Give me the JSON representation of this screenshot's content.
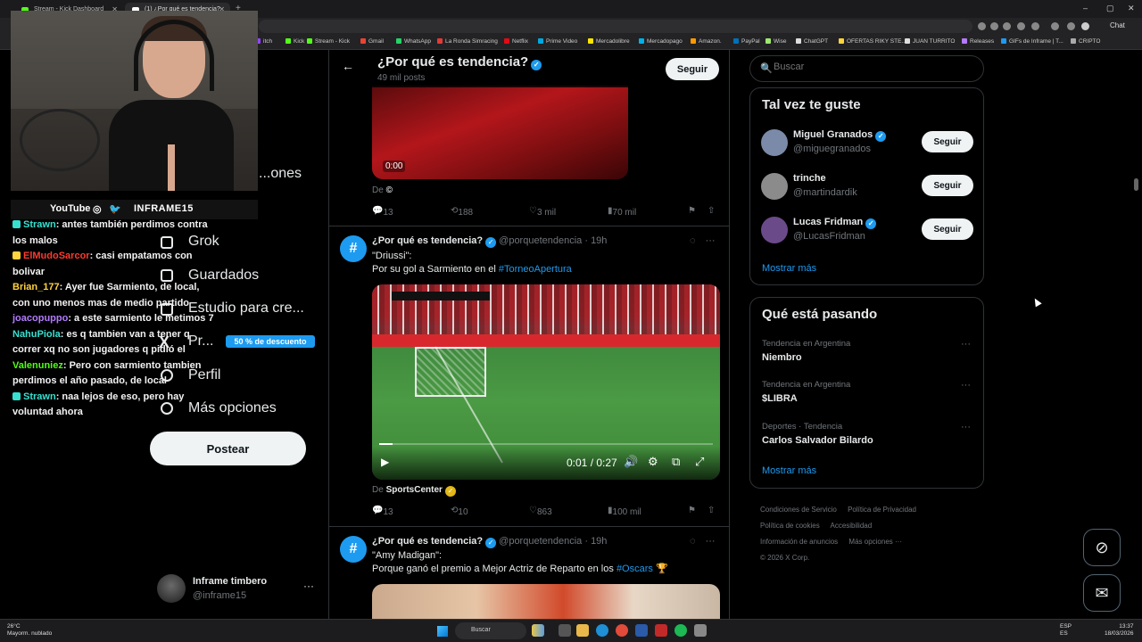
{
  "browser": {
    "tabs": [
      {
        "title": "Stream - Kick Dashboard"
      },
      {
        "title": "(1) ¿Por qué es tendencia? (@porq"
      }
    ],
    "new_tab": "+",
    "window_controls": {
      "minimize": "–",
      "maximize": "▢",
      "close": "✕"
    },
    "chat_extension": "Chat",
    "bookmarks": [
      {
        "label": "itch",
        "color": "#9146ff"
      },
      {
        "label": "Kick",
        "color": "#53fc18"
      },
      {
        "label": "Stream - Kick",
        "color": "#53fc18"
      },
      {
        "label": "Gmail",
        "color": "#ea4335"
      },
      {
        "label": "WhatsApp",
        "color": "#25d366"
      },
      {
        "label": "La Ronda Simracing",
        "color": "#e53935"
      },
      {
        "label": "Netflix",
        "color": "#e50914"
      },
      {
        "label": "Prime Video",
        "color": "#00a8e1"
      },
      {
        "label": "Mercadolibre",
        "color": "#ffe600"
      },
      {
        "label": "Mercadopago",
        "color": "#00b1ea"
      },
      {
        "label": "Amazon.",
        "color": "#ff9900"
      },
      {
        "label": "PayPal",
        "color": "#0070ba"
      },
      {
        "label": "Wise",
        "color": "#9fe870"
      },
      {
        "label": "ChatGPT",
        "color": "#dddddd"
      },
      {
        "label": "OFERTAS RIKY STE...",
        "color": "#ffd23f"
      },
      {
        "label": "JUAN TURRITO",
        "color": "#dddddd"
      },
      {
        "label": "Releases",
        "color": "#b47bff"
      },
      {
        "label": "GIFs de Inframe | T...",
        "color": "#1d9bf0"
      },
      {
        "label": "CRIPTO",
        "color": "#aaaaaa"
      }
    ]
  },
  "stream": {
    "socials": {
      "youtube": "YouTube",
      "handle": "INFRAME15"
    },
    "chat": [
      {
        "user": "Strawn",
        "message": ": antes también perdimos contra los malos",
        "color": "u-cyan",
        "badge": "#37e0d0"
      },
      {
        "user": "ElMudoSarcor",
        "message": ": casi empatamos con bolivar",
        "color": "u-red",
        "badge": "#ffd23f"
      },
      {
        "user": "Brian_177",
        "message": ": Ayer fue Sarmiento, de local, con uno menos mas de medio partido",
        "color": "u-yellow",
        "badge": ""
      },
      {
        "user": "joacopuppo",
        "message": ": a este sarmiento le metimos 7",
        "color": "u-purple",
        "badge": ""
      },
      {
        "user": "NahuPiola",
        "message": ": es q tambien van a tener q correr xq no son jugadores q pidió el",
        "color": "u-cyan",
        "badge": ""
      },
      {
        "user": "Valenuniez",
        "message": ": Pero con sarmiento tambien perdimos el año pasado, de local",
        "color": "u-green",
        "badge": ""
      },
      {
        "user": "Strawn",
        "message": ": naa lejos de eso, pero hay voluntad ahora",
        "color": "u-cyan",
        "badge": "#37e0d0"
      }
    ]
  },
  "nav": {
    "items": [
      {
        "label": "...ones"
      },
      {
        "label": "Grok"
      },
      {
        "label": "Guardados"
      },
      {
        "label": "Estudio para cre..."
      },
      {
        "label": "Pr..."
      },
      {
        "label": "Perfil"
      },
      {
        "label": "Más opciones"
      }
    ],
    "premium_badge": "50 % de descuento",
    "post_button": "Postear",
    "account": {
      "name": "Inframe timbero",
      "handle": "@inframe15",
      "more": "···"
    }
  },
  "timeline": {
    "title": "¿Por qué es tendencia?",
    "post_count": "49 mil posts",
    "follow_label": "Seguir",
    "posts": [
      {
        "media_time": "0:00",
        "source_prefix": "De",
        "source": "©",
        "stats": {
          "replies": "13",
          "reposts": "188",
          "likes": "3 mil",
          "views": "70 mil"
        }
      },
      {
        "author": "¿Por qué es tendencia?",
        "handle": "@porquetendencia",
        "time": "· 19h",
        "line1": "\"Driussi\":",
        "line2_prefix": "Por su gol a Sarmiento en el ",
        "hashtag": "#TorneoApertura",
        "video_time": "0:01 / 0:27",
        "video_progress": 0.04,
        "source_prefix": "De",
        "source": "SportsCenter",
        "stats": {
          "replies": "13",
          "reposts": "10",
          "likes": "863",
          "views": "100 mil"
        }
      },
      {
        "author": "¿Por qué es tendencia?",
        "handle": "@porquetendencia",
        "time": "· 19h",
        "line1": "\"Amy Madigan\":",
        "line2_prefix": "Porque ganó el premio a Mejor Actriz de Reparto en los ",
        "hashtag": "#Oscars",
        "line2_suffix": " 🏆"
      }
    ]
  },
  "sidebar": {
    "search_placeholder": "Buscar",
    "who_to_follow": {
      "title": "Tal vez te guste",
      "users": [
        {
          "name": "Miguel Granados",
          "handle": "@miguegranados",
          "follow": "Seguir",
          "avatar_color": "#7a8aa8"
        },
        {
          "name": "trinche",
          "handle": "@martindardik",
          "follow": "Seguir",
          "avatar_color": "#8b8b8b"
        },
        {
          "name": "Lucas Fridman",
          "handle": "@LucasFridman",
          "follow": "Seguir",
          "avatar_color": "#6b4a8a"
        }
      ],
      "show_more": "Mostrar más"
    },
    "trends": {
      "title": "Qué está pasando",
      "items": [
        {
          "context": "Tendencia en Argentina",
          "name": "Niembro"
        },
        {
          "context": "Tendencia en Argentina",
          "name": "$LIBRA"
        },
        {
          "context": "Deportes · Tendencia",
          "name": "Carlos Salvador Bilardo"
        }
      ],
      "show_more": "Mostrar más"
    },
    "footer": [
      "Condiciones de Servicio",
      "Política de Privacidad",
      "Política de cookies",
      "Accesibilidad",
      "Información de anuncios",
      "Más opciones ···",
      "© 2026 X Corp."
    ]
  },
  "taskbar": {
    "weather_temp": "26°C",
    "weather_desc": "Mayorm. nublado",
    "search": "Buscar",
    "language": "ESP",
    "language_sub": "ES",
    "time": "13:37",
    "date": "18/03/2026"
  }
}
